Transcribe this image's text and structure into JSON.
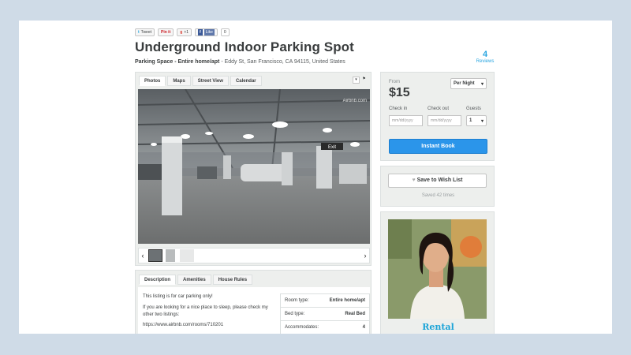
{
  "social": {
    "tweet": "Tweet",
    "pinit": "Pin it",
    "gplus": "+1",
    "like": "Like",
    "like_count": "0"
  },
  "listing": {
    "title": "Underground Indoor Parking Spot",
    "type": "Parking Space - Entire home/apt",
    "address": " - Eddy St, San Francisco, CA 94115, United States"
  },
  "reviews": {
    "count": "4",
    "label": "Reviews"
  },
  "photo_tabs": [
    "Photos",
    "Maps",
    "Street View",
    "Calendar"
  ],
  "photo": {
    "watermark": "Airbnb.com",
    "exit_sign": "Exit"
  },
  "info_tabs": [
    "Description",
    "Amenities",
    "House Rules"
  ],
  "description": {
    "line1": "This listing is for car parking only!",
    "line2": "If you are looking for a nice place to sleep, please check my other two listings:",
    "line3": "https://www.airbnb.com/rooms/710201"
  },
  "details": [
    {
      "key": "Room type:",
      "value": "Entire home/apt"
    },
    {
      "key": "Bed type:",
      "value": "Real Bed"
    },
    {
      "key": "Accommodates:",
      "value": "4"
    }
  ],
  "booking": {
    "from_label": "From",
    "price": "$15",
    "period": "Per Night",
    "checkin_label": "Check in",
    "checkout_label": "Check out",
    "guests_label": "Guests",
    "date_placeholder": "mm/dd/yyyy",
    "guests_value": "1",
    "instant_book": "Instant Book"
  },
  "wishlist": {
    "button": "Save to Wish List",
    "saved": "Saved 42 times"
  },
  "host": {
    "caption": "Rental"
  },
  "colors": {
    "accent": "#2b95ea",
    "link": "#29a5e0",
    "background": "#cfdbe7"
  }
}
